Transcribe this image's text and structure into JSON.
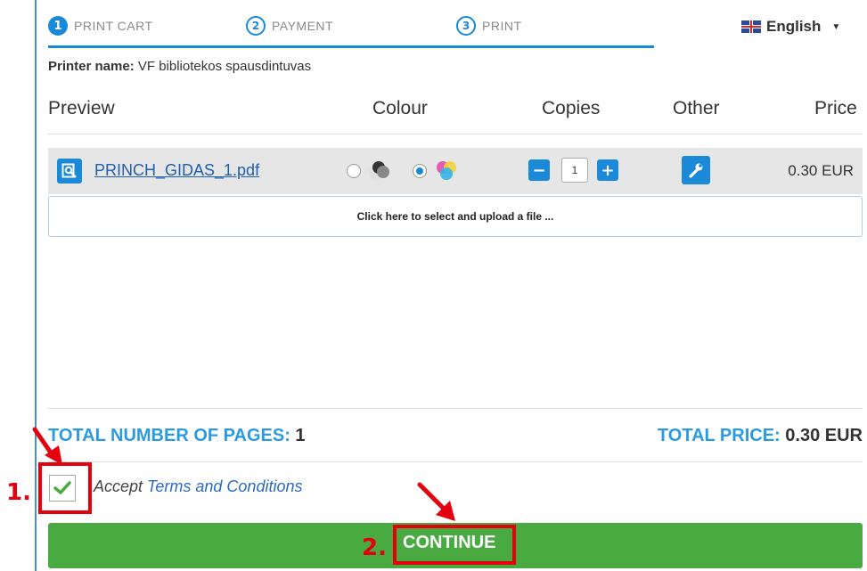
{
  "steps": [
    {
      "num": "1",
      "label": "PRINT CART"
    },
    {
      "num": "2",
      "label": "PAYMENT"
    },
    {
      "num": "3",
      "label": "PRINT"
    }
  ],
  "language": {
    "label": "English"
  },
  "printer": {
    "label": "Printer name:",
    "value": "VF bibliotekos spausdintuvas"
  },
  "columns": {
    "preview": "Preview",
    "colour": "Colour",
    "copies": "Copies",
    "other": "Other",
    "price": "Price"
  },
  "file": {
    "name": "PRINCH_GIDAS_1.pdf",
    "copies": "1",
    "price": "0.30 EUR",
    "colour_selected": "colour"
  },
  "upload": {
    "label": "Click here to select and upload a file ..."
  },
  "totals": {
    "pages_label": "TOTAL NUMBER OF PAGES:",
    "pages_value": "1",
    "price_label": "TOTAL PRICE:",
    "price_value": "0.30 EUR"
  },
  "terms": {
    "accept": "Accept",
    "link": "Terms and Conditions",
    "checked": true
  },
  "continue": {
    "label": "CONTINUE"
  },
  "annotations": {
    "one": "1.",
    "two": "2."
  },
  "colors": {
    "accent": "#1a8ad8",
    "continue": "#4aaa42",
    "annotation": "#e3000f",
    "totals": "#2a9be0"
  }
}
